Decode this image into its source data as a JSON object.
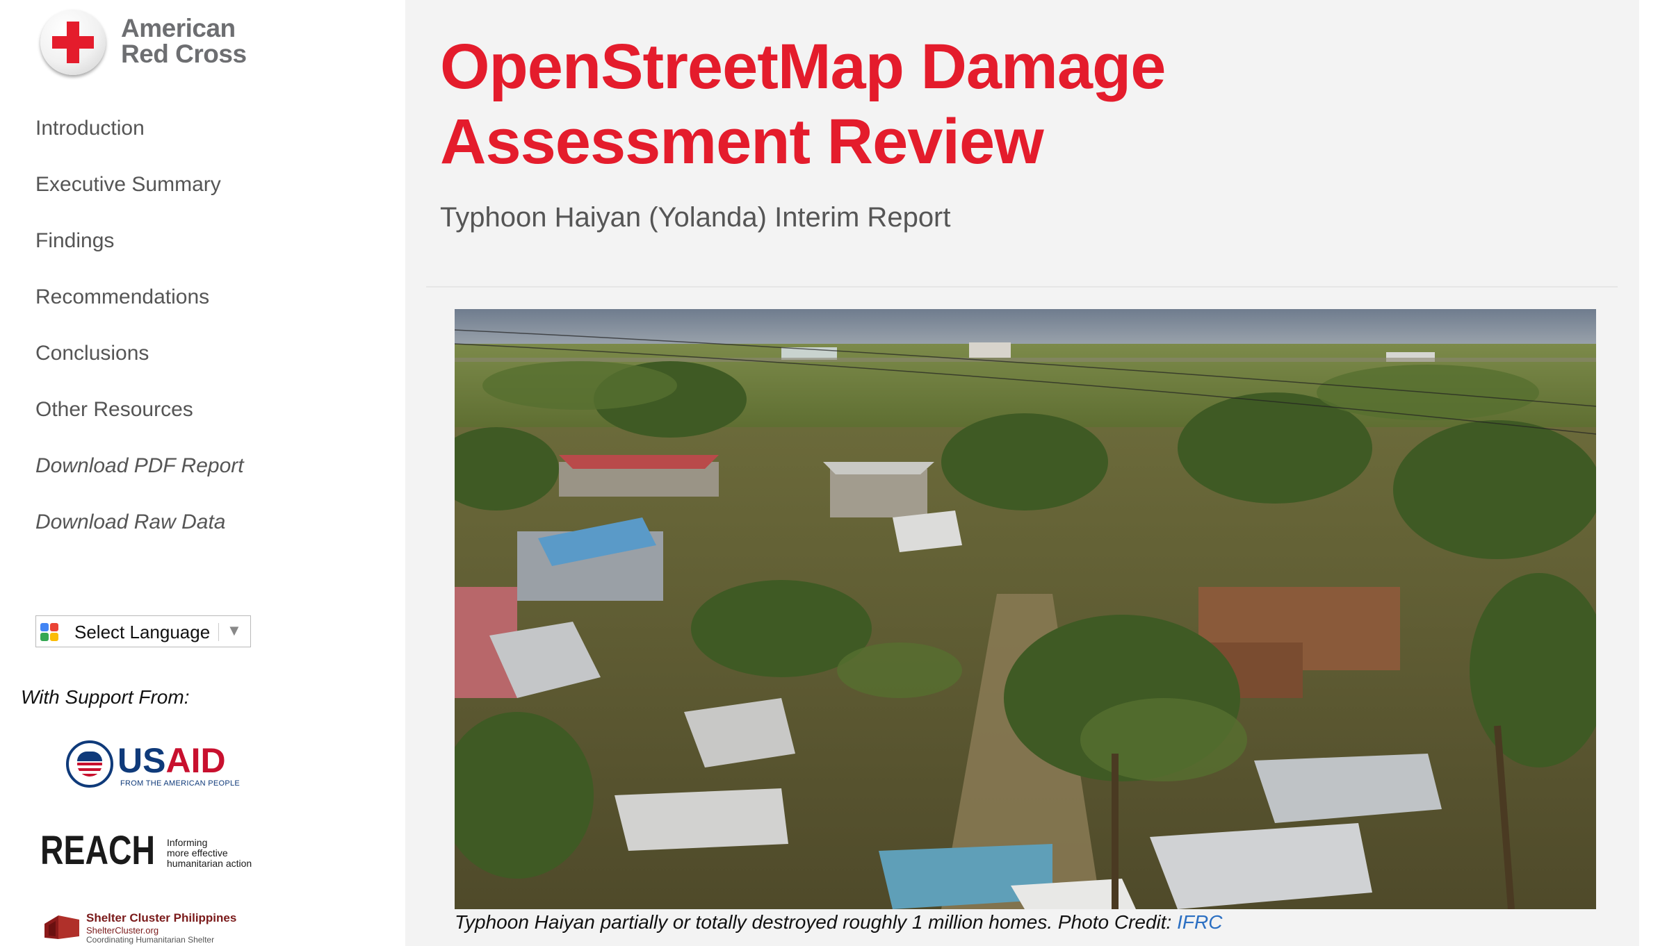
{
  "brand": {
    "name_line1": "American",
    "name_line2": "Red Cross",
    "accent_color": "#e41c2c",
    "text_color": "#6d6e71"
  },
  "nav": {
    "items": [
      {
        "label": "Introduction"
      },
      {
        "label": "Executive Summary"
      },
      {
        "label": "Findings"
      },
      {
        "label": "Recommendations"
      },
      {
        "label": "Conclusions"
      },
      {
        "label": "Other Resources"
      },
      {
        "label": "Download PDF Report"
      },
      {
        "label": "Download Raw Data"
      }
    ]
  },
  "language_select": {
    "label": "Select Language",
    "arrow": "▼",
    "icon": "google-translate-icon"
  },
  "support": {
    "heading": "With Support From:",
    "usaid": {
      "name_part1": "US",
      "name_part2": "AID",
      "tagline": "FROM THE AMERICAN PEOPLE"
    },
    "reach": {
      "name": "REACH",
      "tagline_line1": "Informing",
      "tagline_line2": "more effective",
      "tagline_line3": "humanitarian action"
    },
    "shelter": {
      "title": "Shelter Cluster Philippines",
      "site": "ShelterCluster.org",
      "tagline": "Coordinating Humanitarian Shelter"
    }
  },
  "header": {
    "title": "OpenStreetMap Damage Assessment Review",
    "subtitle": "Typhoon Haiyan (Yolanda) Interim Report"
  },
  "hero": {
    "caption": "Typhoon Haiyan partially or totally destroyed roughly 1 million homes. Photo Credit: ",
    "credit_link": "IFRC"
  },
  "colors": {
    "title_red": "#e41c2c",
    "link_blue": "#2b6fc2",
    "main_bg": "#f3f3f3"
  }
}
